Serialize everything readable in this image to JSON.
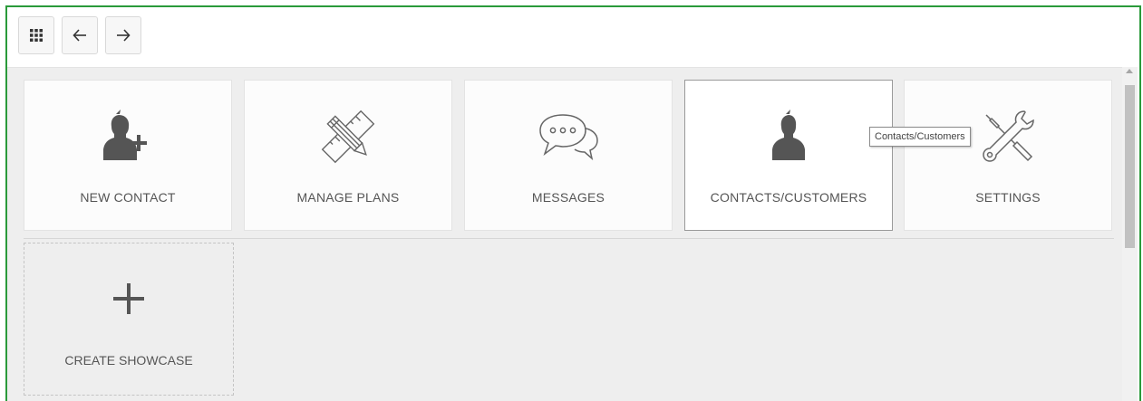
{
  "toolbar": {
    "buttons": [
      {
        "name": "apps-grid",
        "icon": "grid-icon"
      },
      {
        "name": "back",
        "icon": "arrow-left-icon"
      },
      {
        "name": "forward",
        "icon": "arrow-right-icon"
      }
    ]
  },
  "tiles": [
    {
      "label": "NEW CONTACT",
      "icon": "user-add-icon"
    },
    {
      "label": "MANAGE PLANS",
      "icon": "pencil-ruler-icon"
    },
    {
      "label": "MESSAGES",
      "icon": "chat-bubbles-icon"
    },
    {
      "label": "CONTACTS/CUSTOMERS",
      "icon": "user-icon",
      "active": true
    },
    {
      "label": "SETTINGS",
      "icon": "tools-icon"
    }
  ],
  "create": {
    "label": "CREATE SHOWCASE",
    "icon": "plus-icon"
  },
  "tooltip": {
    "text": "Contacts/Customers"
  },
  "colors": {
    "frame": "#2a9a3a",
    "content_bg": "#eeeeee",
    "icon": "#555555"
  }
}
